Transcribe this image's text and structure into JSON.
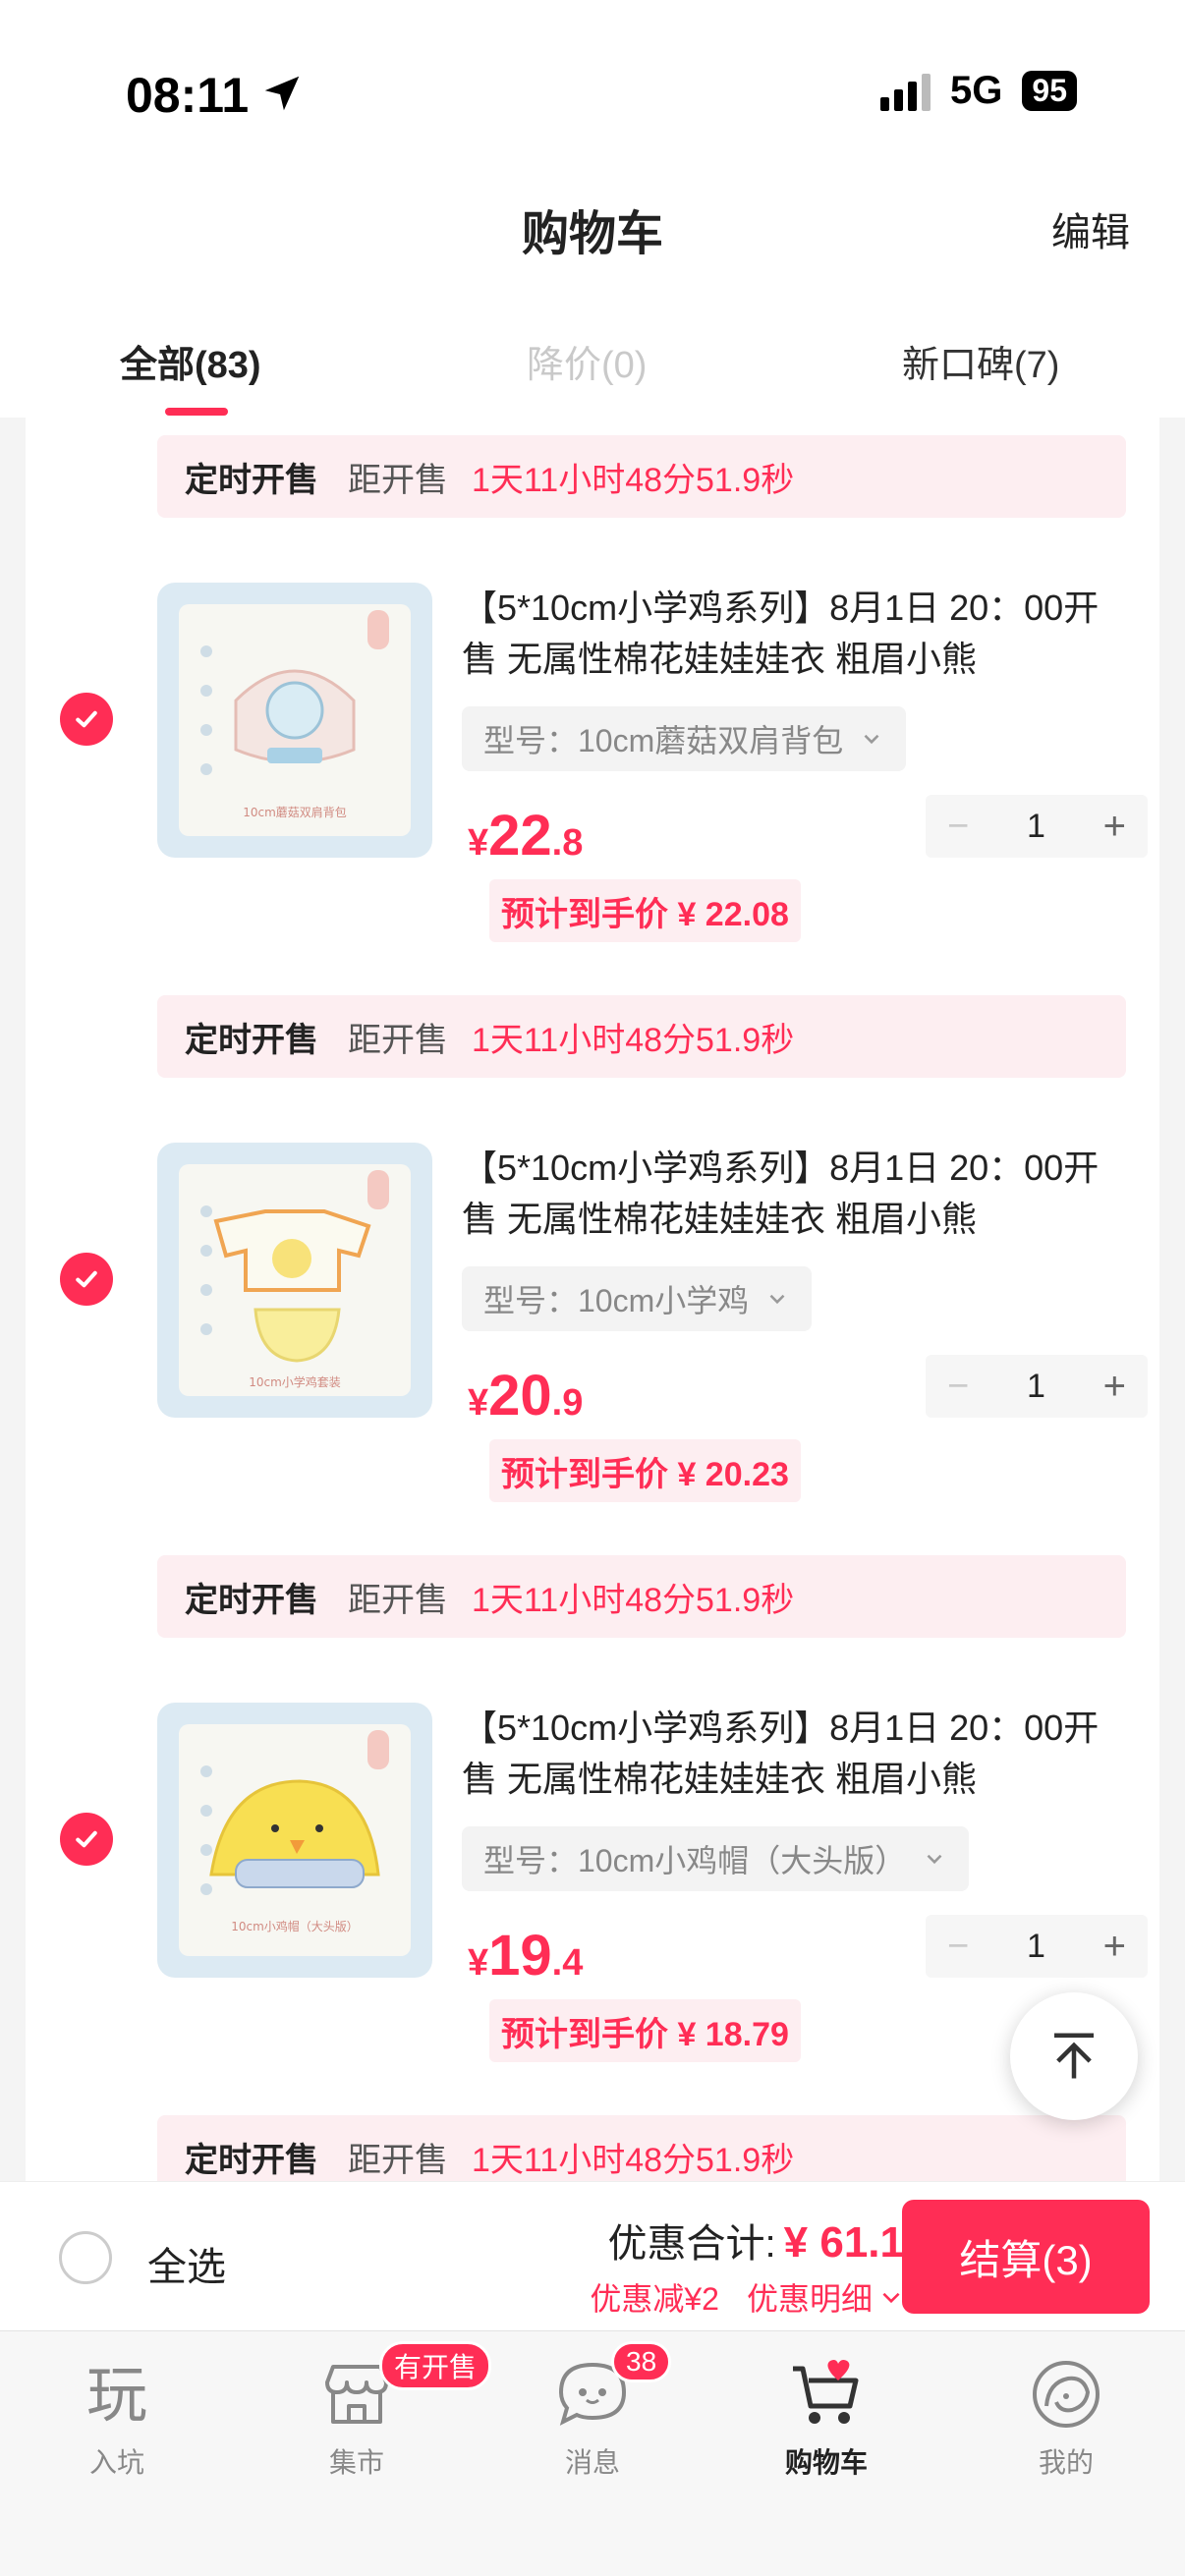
{
  "status": {
    "time": "08:11",
    "network": "5G",
    "battery": "95"
  },
  "header": {
    "title": "购物车",
    "edit": "编辑"
  },
  "tabs": [
    {
      "label": "全部(83)",
      "state": "active"
    },
    {
      "label": "降价(0)",
      "state": "disabled"
    },
    {
      "label": "新口碑(7)",
      "state": "normal"
    }
  ],
  "banner": {
    "tag": "定时开售",
    "label": "距开售",
    "countdown": "1天11小时48分51.9秒"
  },
  "items": [
    {
      "title": "【5*10cm小学鸡系列】8月1日 20：00开售 无属性棉花娃娃娃衣 粗眉小熊",
      "variant": "型号：10cm蘑菇双肩背包",
      "price_symbol": "¥",
      "price_int": "22",
      "price_dec": ".8",
      "quantity": "1",
      "estimate": "预计到手价 ¥ 22.08",
      "checked": true
    },
    {
      "title": "【5*10cm小学鸡系列】8月1日 20：00开售 无属性棉花娃娃娃衣 粗眉小熊",
      "variant": "型号：10cm小学鸡",
      "price_symbol": "¥",
      "price_int": "20",
      "price_dec": ".9",
      "quantity": "1",
      "estimate": "预计到手价 ¥ 20.23",
      "checked": true
    },
    {
      "title": "【5*10cm小学鸡系列】8月1日 20：00开售 无属性棉花娃娃娃衣 粗眉小熊",
      "variant": "型号：10cm小鸡帽（大头版）",
      "price_symbol": "¥",
      "price_int": "19",
      "price_dec": ".4",
      "quantity": "1",
      "estimate": "预计到手价 ¥ 18.79",
      "checked": true
    }
  ],
  "stepper": {
    "minus": "−",
    "plus": "+"
  },
  "checkout": {
    "select_all": "全选",
    "total_label": "优惠合计:",
    "total_value": "¥ 61.1",
    "discount": "优惠减¥2",
    "detail": "优惠明细",
    "pay": "结算(3)"
  },
  "tabbar": [
    {
      "label": "入坑",
      "icon": "play-icon"
    },
    {
      "label": "集市",
      "icon": "store-icon",
      "badge": "有开售"
    },
    {
      "label": "消息",
      "icon": "message-icon",
      "badge": "38"
    },
    {
      "label": "购物车",
      "icon": "cart-icon",
      "active": true
    },
    {
      "label": "我的",
      "icon": "profile-icon"
    }
  ],
  "colors": {
    "accent": "#ff2d55",
    "banner_bg": "#fdeef1"
  }
}
